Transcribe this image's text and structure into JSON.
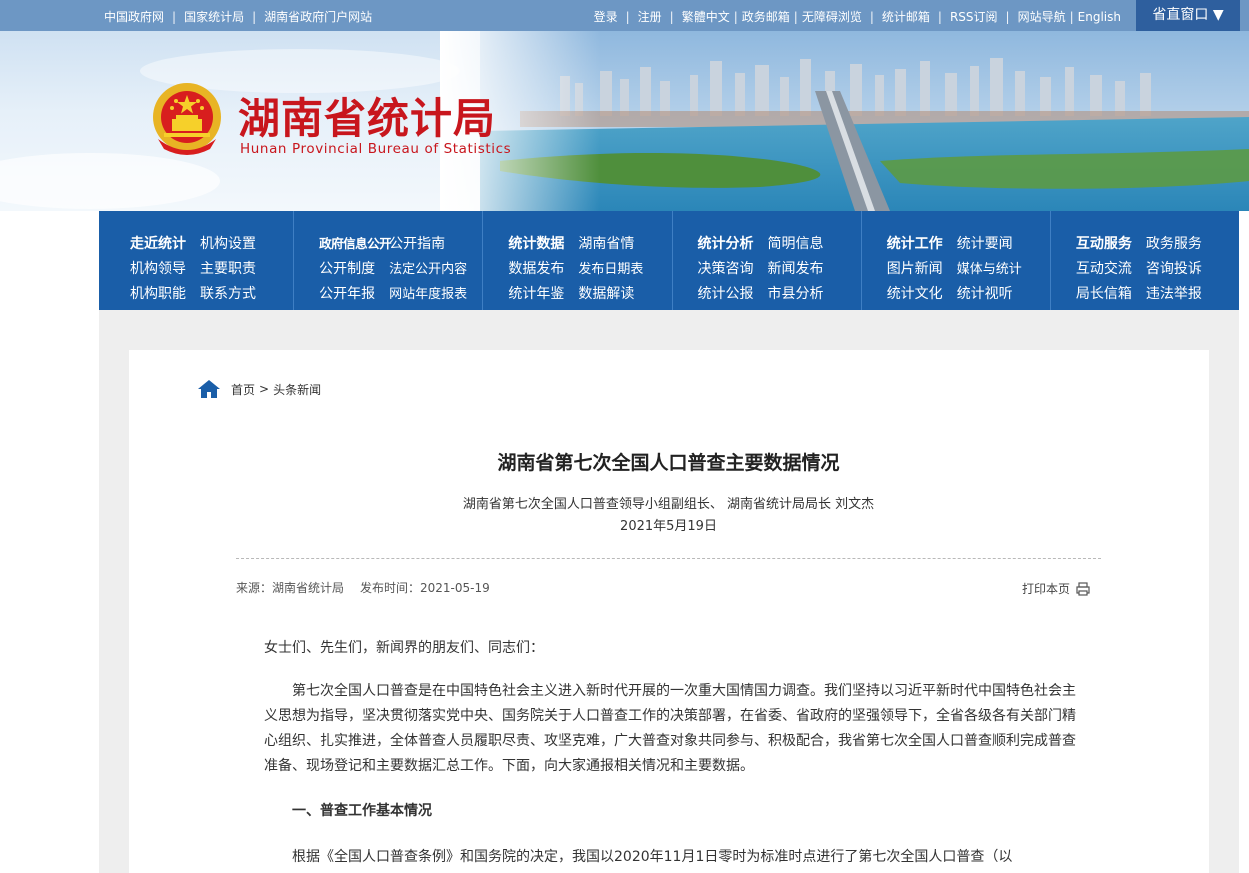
{
  "topbar": {
    "left_links": [
      "中国政府网",
      "国家统计局",
      "湖南省政府门户网站"
    ],
    "right_links": [
      "登录",
      "注册",
      "繁體中文",
      "政务邮箱",
      "无障碍浏览",
      "统计邮箱",
      "RSS订阅",
      "网站导航",
      "English"
    ],
    "window_button": "省直窗口 ▼"
  },
  "site": {
    "title": "湖南省统计局",
    "subtitle": "Hunan Provincial Bureau of Statistics"
  },
  "nav": {
    "groups": [
      {
        "rows": [
          [
            "走近统计",
            "机构设置"
          ],
          [
            "机构领导",
            "主要职责"
          ],
          [
            "机构职能",
            "联系方式"
          ]
        ]
      },
      {
        "rows": [
          [
            "政府信息公开",
            "公开指南"
          ],
          [
            "公开制度",
            "法定公开内容"
          ],
          [
            "公开年报",
            "网站年度报表"
          ]
        ]
      },
      {
        "rows": [
          [
            "统计数据",
            "湖南省情"
          ],
          [
            "数据发布",
            "发布日期表"
          ],
          [
            "统计年鉴",
            "数据解读"
          ]
        ]
      },
      {
        "rows": [
          [
            "统计分析",
            "简明信息"
          ],
          [
            "决策咨询",
            "新闻发布"
          ],
          [
            "统计公报",
            "市县分析"
          ]
        ]
      },
      {
        "rows": [
          [
            "统计工作",
            "统计要闻"
          ],
          [
            "图片新闻",
            "媒体与统计"
          ],
          [
            "统计文化",
            "统计视听"
          ]
        ]
      },
      {
        "rows": [
          [
            "互动服务",
            "政务服务"
          ],
          [
            "互动交流",
            "咨询投诉"
          ],
          [
            "局长信箱",
            "违法举报"
          ]
        ]
      }
    ]
  },
  "breadcrumb": {
    "home": "首页",
    "separator": ">",
    "current": "头条新闻"
  },
  "article": {
    "title": "湖南省第七次全国人口普查主要数据情况",
    "author": "湖南省第七次全国人口普查领导小组副组长、 湖南省统计局局长 刘文杰",
    "date": "2021年5月19日",
    "source_label": "来源：湖南省统计局",
    "publish_label": "发布时间：2021-05-19",
    "print_label": "打印本页",
    "greeting": "女士们、先生们，新闻界的朋友们、同志们：",
    "paragraph1": "第七次全国人口普查是在中国特色社会主义进入新时代开展的一次重大国情国力调查。我们坚持以习近平新时代中国特色社会主义思想为指导，坚决贯彻落实党中央、国务院关于人口普查工作的决策部署，在省委、省政府的坚强领导下，全省各级各有关部门精心组织、扎实推进，全体普查人员履职尽责、攻坚克难，广大普查对象共同参与、积极配合，我省第七次全国人口普查顺利完成普查准备、现场登记和主要数据汇总工作。下面，向大家通报相关情况和主要数据。",
    "section1": "一、普查工作基本情况",
    "paragraph2": "根据《全国人口普查条例》和国务院的决定，我国以2020年11月1日零时为标准时点进行了第七次全国人口普查（以"
  },
  "colors": {
    "topbar": "#6d97c4",
    "nav": "#1a5ea8",
    "title_red": "#c8161d",
    "window_button": "#2e5f9e"
  }
}
